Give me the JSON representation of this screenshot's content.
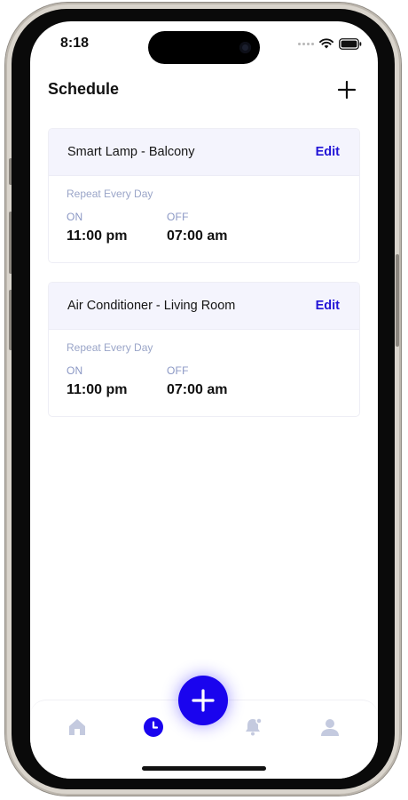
{
  "status_bar": {
    "time": "8:18"
  },
  "header": {
    "title": "Schedule",
    "add_icon": "plus-icon"
  },
  "schedules": [
    {
      "device": "Smart Lamp - Balcony",
      "edit_label": "Edit",
      "repeat": "Repeat Every Day",
      "on_label": "ON",
      "on_time": "11:00 pm",
      "off_label": "OFF",
      "off_time": "07:00 am"
    },
    {
      "device": "Air Conditioner - Living Room",
      "edit_label": "Edit",
      "repeat": "Repeat Every Day",
      "on_label": "ON",
      "on_time": "11:00 pm",
      "off_label": "OFF",
      "off_time": "07:00 am"
    }
  ],
  "nav": {
    "items": [
      "home-icon",
      "clock-icon",
      "add-icon",
      "bell-icon",
      "user-icon"
    ],
    "active": "clock-icon"
  },
  "colors": {
    "accent": "#1a04ee",
    "card_header": "#f4f4fd",
    "inactive_icon": "#c4cadf"
  }
}
